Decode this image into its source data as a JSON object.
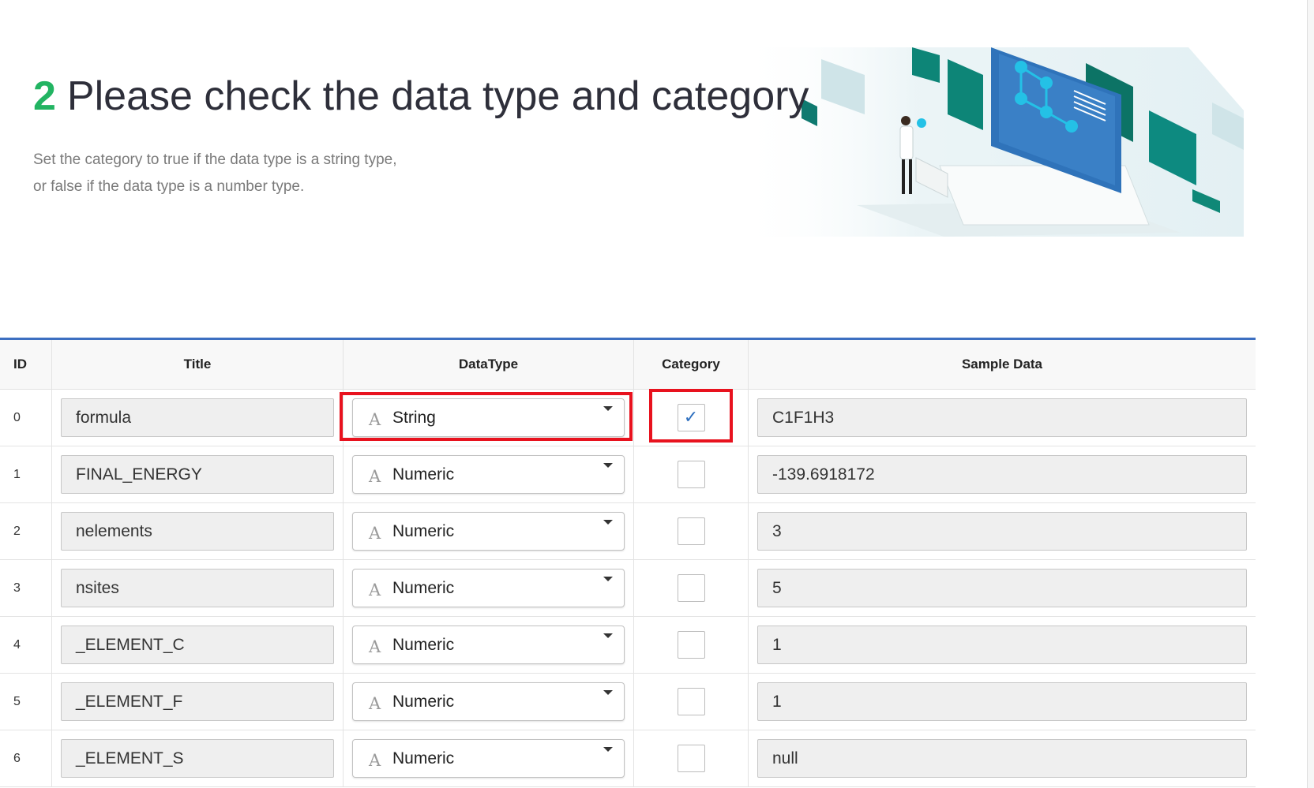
{
  "header": {
    "step_number": "2",
    "title": "Please check the data type and category",
    "description_line1": "Set the category to true if the data type is a string type,",
    "description_line2": "or false if the data type is a number type."
  },
  "table": {
    "columns": {
      "id": "ID",
      "title": "Title",
      "data_type": "DataType",
      "category": "Category",
      "sample_data": "Sample Data"
    },
    "rows": [
      {
        "id": "0",
        "title": "formula",
        "data_type": "String",
        "category": true,
        "sample": "C1F1H3"
      },
      {
        "id": "1",
        "title": "FINAL_ENERGY",
        "data_type": "Numeric",
        "category": false,
        "sample": "-139.6918172"
      },
      {
        "id": "2",
        "title": "nelements",
        "data_type": "Numeric",
        "category": false,
        "sample": "3"
      },
      {
        "id": "3",
        "title": "nsites",
        "data_type": "Numeric",
        "category": false,
        "sample": "5"
      },
      {
        "id": "4",
        "title": "_ELEMENT_C",
        "data_type": "Numeric",
        "category": false,
        "sample": "1"
      },
      {
        "id": "5",
        "title": "_ELEMENT_F",
        "data_type": "Numeric",
        "category": false,
        "sample": "1"
      },
      {
        "id": "6",
        "title": "_ELEMENT_S",
        "data_type": "Numeric",
        "category": false,
        "sample": "null"
      }
    ]
  },
  "icons": {
    "type_icon_glyph": "A",
    "check_glyph": "✓"
  },
  "colors": {
    "step_green": "#22b462",
    "table_accent": "#3d6fc1",
    "highlight_red": "#e8121e",
    "check_blue": "#2d6fbf"
  }
}
